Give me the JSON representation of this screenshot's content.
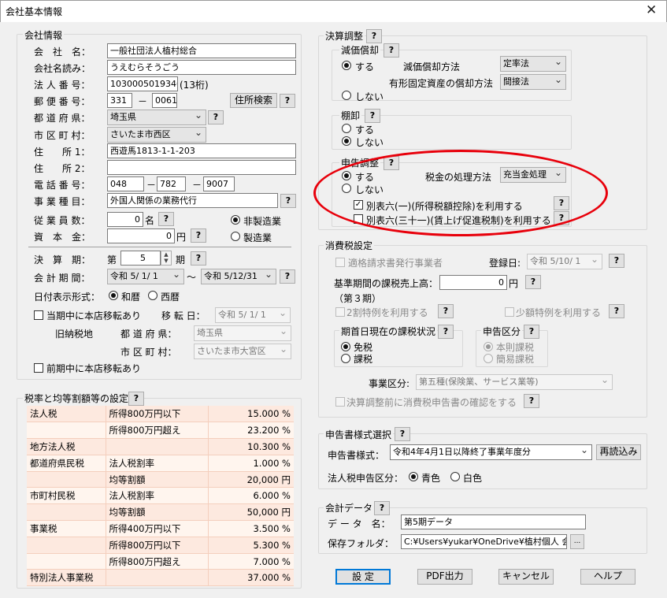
{
  "window": {
    "title": "会社基本情報",
    "close": "✕"
  },
  "company": {
    "group_title": "会社情報",
    "name_label": "会　社　名：",
    "name_value": "一般社団法人植村総合",
    "kana_label": "会社名読み：",
    "kana_value": "うえむらそうごう",
    "houjin_label": "法 人 番 号：",
    "houjin_value": "1030005019346",
    "houjin_note": "(13桁)",
    "postal_label": "郵 便 番 号：",
    "postal1": "331",
    "postal_dash": "－",
    "postal2": "0061",
    "address_search": "住所検索",
    "pref_label": "都 道 府 県：",
    "pref_value": "埼玉県",
    "city_label": "市 区 町 村：",
    "city_value": "さいたま市西区",
    "addr1_label": "住　　所 1：",
    "addr1_value": "西遊馬1813-1-1-203",
    "addr2_label": "住　　所 2：",
    "addr2_value": "",
    "tel_label": "電 話 番 号：",
    "tel1": "048",
    "tel2": "782",
    "tel3": "9007",
    "tel_dash": "－",
    "biz_label": "事 業 種 目：",
    "biz_value": "外国人関係の業務代行",
    "emp_label": "従 業 員 数：",
    "emp_value": "0",
    "emp_unit": "名",
    "cap_label": "資　本　金：",
    "cap_value": "0",
    "cap_unit": "円",
    "radio_nonmfg": "非製造業",
    "radio_mfg": "製造業",
    "fiscal_label": "決　算　期：",
    "fiscal_prefix": "第",
    "fiscal_value": "5",
    "fiscal_unit": "期",
    "period_label": "会 計 期 間：",
    "period_start": "令和 5/ 1/ 1",
    "period_tilde": "～",
    "period_end": "令和 5/12/31",
    "datefmt_label": "日付表示形式：",
    "datefmt_wareki": "和暦",
    "datefmt_seireki": "西暦",
    "move_check_label": "当期中に本店移転あり",
    "move_date_label": "移 転 日：",
    "move_date_value": "令和 5/ 1/ 1",
    "old_tax_label": "旧納税地",
    "old_pref_label": "都 道 府 県：",
    "old_pref_value": "埼玉県",
    "old_city_label": "市 区 町 村：",
    "old_city_value": "さいたま市大宮区",
    "prev_move_label": "前期中に本店移転あり",
    "q": "?"
  },
  "tax_table": {
    "group_title": "税率と均等割額等の設定",
    "rows": [
      {
        "c1": "法人税",
        "c2": "所得800万円以下",
        "c3": "15.000 %"
      },
      {
        "c1": "",
        "c2": "所得800万円超え",
        "c3": "23.200 %"
      },
      {
        "c1": "地方法人税",
        "c2": "",
        "c3": "10.300 %"
      },
      {
        "c1": "都道府県民税",
        "c2": "法人税割率",
        "c3": "1.000 %"
      },
      {
        "c1": "",
        "c2": "均等割額",
        "c3": "20,000 円"
      },
      {
        "c1": "市町村民税",
        "c2": "法人税割率",
        "c3": "6.000 %"
      },
      {
        "c1": "",
        "c2": "均等割額",
        "c3": "50,000 円"
      },
      {
        "c1": "事業税",
        "c2": "所得400万円以下",
        "c3": "3.500 %"
      },
      {
        "c1": "",
        "c2": "所得800万円以下",
        "c3": "5.300 %"
      },
      {
        "c1": "",
        "c2": "所得800万円超え",
        "c3": "7.000 %"
      },
      {
        "c1": "特別法人事業税",
        "c2": "",
        "c3": "37.000 %"
      }
    ]
  },
  "kessan": {
    "group_title": "決算調整",
    "genka_title": "減価償却",
    "genka_yes": "する",
    "genka_no": "しない",
    "genka_method_label": "減価償却方法",
    "genka_method_value": "定率法",
    "yuukei_label": "有形固定資産の償却方法",
    "yuukei_value": "間接法",
    "tana_title": "棚卸",
    "tana_yes": "する",
    "tana_no": "しない",
    "shinkoku_title": "申告調整",
    "shinkoku_yes": "する",
    "shinkoku_no": "しない",
    "zeikin_label": "税金の処理方法",
    "zeikin_value": "充当金処理",
    "beppyo1": "別表六(一)(所得税額控除)を利用する",
    "beppyo2": "別表六(三十一)(賃上げ促進税制)を利用する"
  },
  "shohi": {
    "group_title": "消費税設定",
    "tekikaku_label": "適格請求書発行事業者",
    "touroku_label": "登録日:",
    "touroku_value": "令和 5/10/ 1",
    "kijun_label": "基準期間の課税売上高：",
    "kijun_value": "0",
    "kijun_unit": "円",
    "kijun_period": "（第３期）",
    "niwari_label": "2割特例を利用する",
    "shougaku_label": "少額特例を利用する",
    "kishu_title": "期首日現在の課税状況",
    "menzei": "免税",
    "kazei": "課税",
    "kubun_title": "申告区分",
    "honsoku": "本則課税",
    "kan_i": "簡易課税",
    "jigyou_label": "事業区分:",
    "jigyou_value": "第五種(保険業、サービス業等)",
    "confirm_label": "決算調整前に消費税申告書の確認をする"
  },
  "shoshiki": {
    "group_title": "申告書様式選択",
    "label": "申告書様式：",
    "value": "令和4年4月1日以降終了事業年度分",
    "reload": "再読込み",
    "color_label": "法人税申告区分：",
    "blue": "青色",
    "white": "白色"
  },
  "kaikei": {
    "group_title": "会計データ",
    "name_label": "デ ー タ　名：",
    "name_value": "第5期データ",
    "folder_label": "保存フォルダ：",
    "folder_value": "C:¥Users¥yukar¥OneDrive¥植村個人 会",
    "browse": "..."
  },
  "buttons": {
    "settei": "設 定",
    "pdf": "PDF出力",
    "cancel": "キャンセル",
    "help": "ヘルプ"
  }
}
